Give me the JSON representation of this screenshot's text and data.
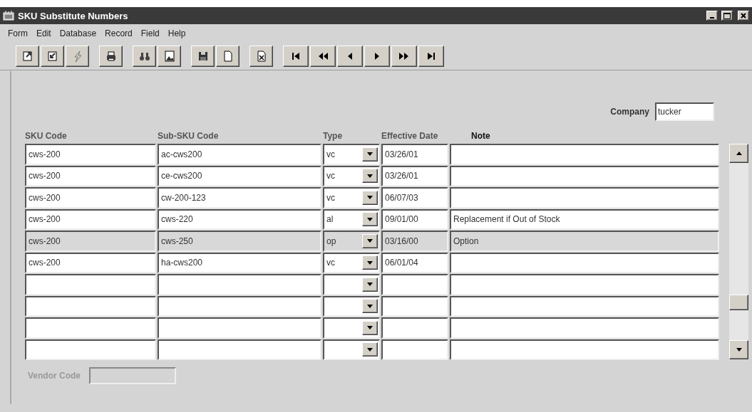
{
  "window": {
    "title": "SKU Substitute Numbers"
  },
  "menu": [
    "Form",
    "Edit",
    "Database",
    "Record",
    "Field",
    "Help"
  ],
  "company": {
    "label": "Company",
    "value": "tucker"
  },
  "columns": [
    "SKU Code",
    "Sub-SKU Code",
    "Type",
    "Effective Date",
    "Note"
  ],
  "rows": [
    {
      "sku": "cws-200",
      "sub_sku": "ac-cws200",
      "type": "vc",
      "date": "03/26/01",
      "selected": false
    },
    {
      "sku": "cws-200",
      "sub_sku": "ce-cws200",
      "type": "vc",
      "date": "03/26/01",
      "selected": false
    },
    {
      "sku": "cws-200",
      "sub_sku": "cw-200-123",
      "type": "vc",
      "date": "06/07/03",
      "selected": false
    },
    {
      "sku": "cws-200",
      "sub_sku": "cws-220",
      "type": "al",
      "date": "09/01/00",
      "note": "Replacement if Out of Stock",
      "selected": false
    },
    {
      "sku": "cws-200",
      "sub_sku": "cws-250",
      "type": "op",
      "date": "03/16/00",
      "note": "Option",
      "selected": true
    },
    {
      "sku": "cws-200",
      "sub_sku": "ha-cws200",
      "type": "vc",
      "date": "06/01/04",
      "selected": false
    },
    {
      "selected": false
    },
    {
      "selected": false
    },
    {
      "selected": false
    },
    {
      "selected": false
    }
  ],
  "vendor_code": {
    "label": "Vendor Code",
    "disabled": true
  }
}
